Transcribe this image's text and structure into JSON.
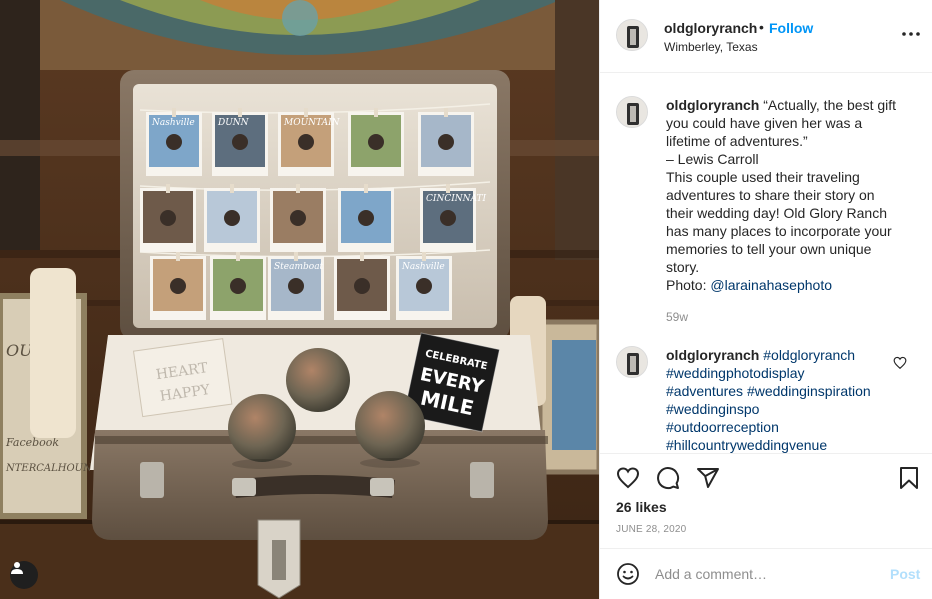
{
  "post": {
    "username": "oldgloryranch",
    "follow_separator": "•",
    "follow_label": "Follow",
    "location": "Wimberley, Texas",
    "more_icon": "more-options-icon"
  },
  "caption": {
    "username": "oldgloryranch",
    "lines": [
      "“Actually, the best gift",
      "you could have given her was a",
      "lifetime of adventures.”",
      "– Lewis Carroll",
      "This couple used their traveling",
      "adventures to share their story on",
      "their wedding day! Old Glory Ranch",
      "has many places to incorporate your",
      "memories to tell your own unique",
      "story."
    ],
    "photo_prefix": "Photo: ",
    "photo_credit": "@larainahasephoto",
    "age": "59w"
  },
  "comment": {
    "username": "oldgloryranch",
    "hashtags": [
      "#oldgloryranch",
      "#weddingphotodisplay",
      "#adventures",
      "#weddinginspiration",
      "#weddinginspo",
      "#outdoorreception",
      "#hillcountryweddingvenue"
    ]
  },
  "actions": {
    "likes": "26 likes",
    "date": "JUNE 28, 2020"
  },
  "add_comment": {
    "placeholder": "Add a comment…",
    "post_label": "Post"
  },
  "photo": {
    "box_text_1": "CELEBRATE",
    "box_text_2": "EVERY",
    "box_text_3": "MILE",
    "block_text_1": "HEART",
    "block_text_2": "HAPPY",
    "photo_labels": [
      "Nashville",
      "DUNN",
      "MOUNTAIN",
      "",
      "",
      "",
      "",
      "",
      "",
      "CINCINNATI",
      "",
      "",
      "Steamboat",
      "",
      "Nashville"
    ]
  },
  "colors": {
    "accent": "#0095f6",
    "link": "#00376b",
    "muted": "#8e8e8e",
    "post_disabled": "#b2dffc"
  }
}
